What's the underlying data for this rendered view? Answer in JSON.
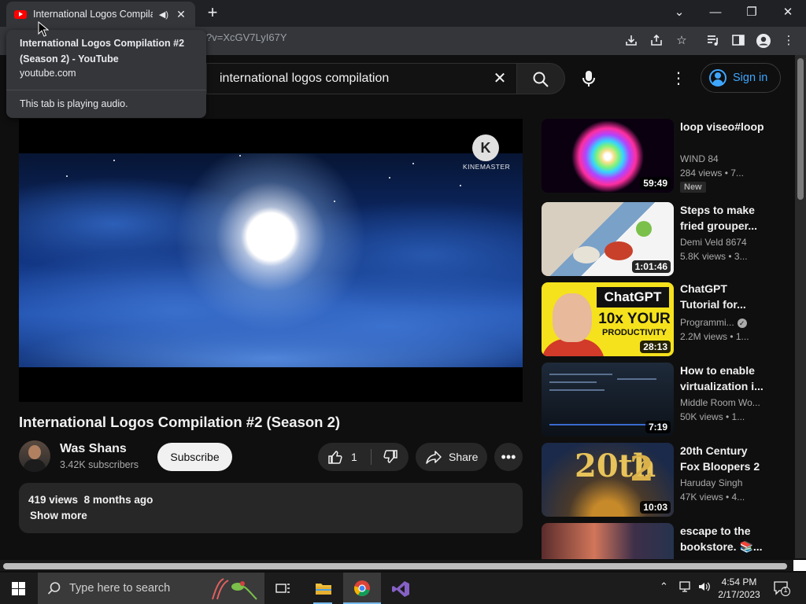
{
  "browser": {
    "tab": {
      "title": "International Logos Compilation #2 (Season 2) - YouTube",
      "audio_icon": "speaker-icon",
      "close_glyph": "✕"
    },
    "new_tab_glyph": "+",
    "window_controls": {
      "tab_search": "⌄",
      "minimize": "—",
      "restore": "❐",
      "close": "✕"
    },
    "url_text": "?v=XcGV7LyI67Y",
    "hover_card": {
      "title": "International Logos Compilation #2 (Season 2) - YouTube",
      "domain": "youtube.com",
      "audio_status": "This tab is playing audio."
    }
  },
  "youtube": {
    "search": {
      "query": "international logos compilation",
      "clear_glyph": "✕"
    },
    "sign_in_label": "Sign in",
    "more_glyph": "⋮",
    "player": {
      "watermark_letter": "K",
      "watermark_text": "KINEMASTER"
    },
    "video": {
      "title": "International Logos Compilation #2 (Season 2)",
      "channel": "Was Shans",
      "subscribers": "3.42K subscribers",
      "subscribe_label": "Subscribe",
      "like_count": "1",
      "share_label": "Share",
      "more_actions_glyph": "•••",
      "views": "419 views",
      "uploaded": "8 months ago",
      "show_more": "Show more"
    },
    "recommendations": [
      {
        "title": "loop viseo#loop",
        "channel": "WIND 84",
        "views": "284 views  •  7...",
        "duration": "59:49",
        "badge": "New",
        "verified": false
      },
      {
        "title": "Steps to make fried grouper...",
        "channel": "Demi Veld 8674",
        "views": "5.8K views  •  3...",
        "duration": "1:01:46",
        "badge": "",
        "verified": false
      },
      {
        "title": "ChatGPT Tutorial for...",
        "channel": "Programmi...",
        "views": "2.2M views  •  1...",
        "duration": "28:13",
        "badge": "",
        "verified": true,
        "thumb_text": [
          "ChatGPT",
          "10x YOUR",
          "PRODUCTIVITY"
        ]
      },
      {
        "title": "How to enable virtualization i...",
        "channel": "Middle Room Wo...",
        "views": "50K views  •  1...",
        "duration": "7:19",
        "badge": "",
        "verified": false
      },
      {
        "title": "20th Century Fox Bloopers 2",
        "channel": "Haruday Singh",
        "views": "47K views  •  4...",
        "duration": "10:03",
        "badge": "",
        "verified": false,
        "thumb_text": [
          "20th",
          "2"
        ]
      },
      {
        "title": "escape to the bookstore. 📚...",
        "channel": "",
        "views": "",
        "duration": "",
        "badge": "",
        "verified": false
      }
    ]
  },
  "taskbar": {
    "search_placeholder": "Type here to search",
    "time": "4:54 PM",
    "date": "2/17/2023",
    "notification_count": "1"
  },
  "colors": {
    "youtube_bg": "#0f0f0f",
    "chrome_tab_active": "#35363a",
    "chrome_tabstrip": "#202124",
    "link_blue": "#3ea6ff",
    "youtube_red": "#ff0000"
  }
}
